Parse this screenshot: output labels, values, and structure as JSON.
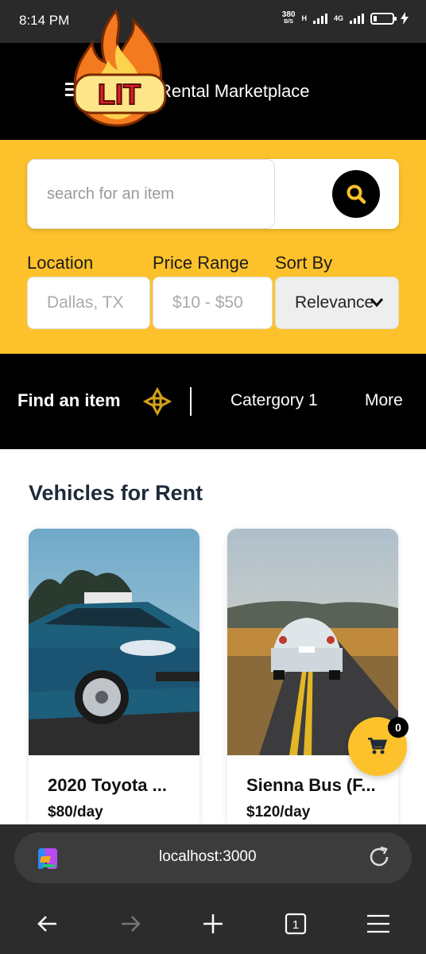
{
  "status_bar": {
    "time": "8:14 PM",
    "net_speed_value": "380",
    "net_speed_unit": "B/S",
    "network_1": "H",
    "network_2": "4G"
  },
  "header": {
    "title": "Rental Marketplace",
    "badge_text": "LIT"
  },
  "search": {
    "placeholder": "search for an item"
  },
  "filters": {
    "location_label": "Location",
    "location_placeholder": "Dallas, TX",
    "price_label": "Price Range",
    "price_placeholder": "$10 - $50",
    "sort_label": "Sort By",
    "sort_value": "Relevance"
  },
  "category_bar": {
    "find_label": "Find an item",
    "category_1": "Catergory 1",
    "more": "More"
  },
  "listing": {
    "section_title": "Vehicles for Rent",
    "items": [
      {
        "name": "2020 Toyota ...",
        "price": "$80/day"
      },
      {
        "name": "Sienna Bus (F...",
        "price": "$120/day"
      }
    ]
  },
  "cart": {
    "count": "0"
  },
  "browser": {
    "url": "localhost:3000",
    "tab_count": "1"
  },
  "colors": {
    "accent_yellow": "#fdc22b",
    "header_black": "#000000"
  }
}
